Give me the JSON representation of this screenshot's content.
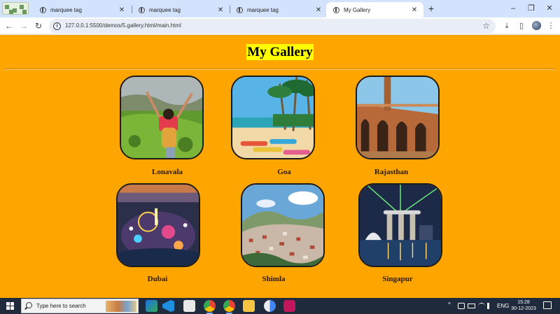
{
  "browser": {
    "tabs": [
      {
        "title": "marquee tag",
        "active": false
      },
      {
        "title": "marquee tag",
        "active": false
      },
      {
        "title": "marquee tag",
        "active": false
      },
      {
        "title": "My Gallery",
        "active": true
      }
    ],
    "close_glyph": "✕",
    "new_tab_glyph": "+",
    "window_controls": {
      "minimize": "–",
      "restore": "❐",
      "close": "✕"
    },
    "url": "127.0.0.1:5500/demos/5.gallery.html/main.html",
    "nav": {
      "back": "←",
      "forward": "→",
      "reload": "↻"
    },
    "icons": {
      "info": "i",
      "star": "☆",
      "download": "⤓",
      "side_panel": "▯",
      "menu": "⋮"
    }
  },
  "page": {
    "heading": "My Gallery",
    "gallery": [
      {
        "caption": "Lonavala",
        "image": "green-hill-traveler"
      },
      {
        "caption": "Goa",
        "image": "beach-palms-kayaks"
      },
      {
        "caption": "Rajasthan",
        "image": "sandstone-arches"
      },
      {
        "caption": "Dubai",
        "image": "night-city-lights"
      },
      {
        "caption": "Shimla",
        "image": "hill-town"
      },
      {
        "caption": "Singapur",
        "image": "marina-bay-night"
      }
    ],
    "background_color": "#ffa500",
    "heading_highlight": "#ffff00"
  },
  "taskbar": {
    "search_placeholder": "Type here to search",
    "tray": {
      "chevron": "^",
      "lang": "ENG"
    },
    "time": "15:28",
    "date": "30-12-2023"
  }
}
